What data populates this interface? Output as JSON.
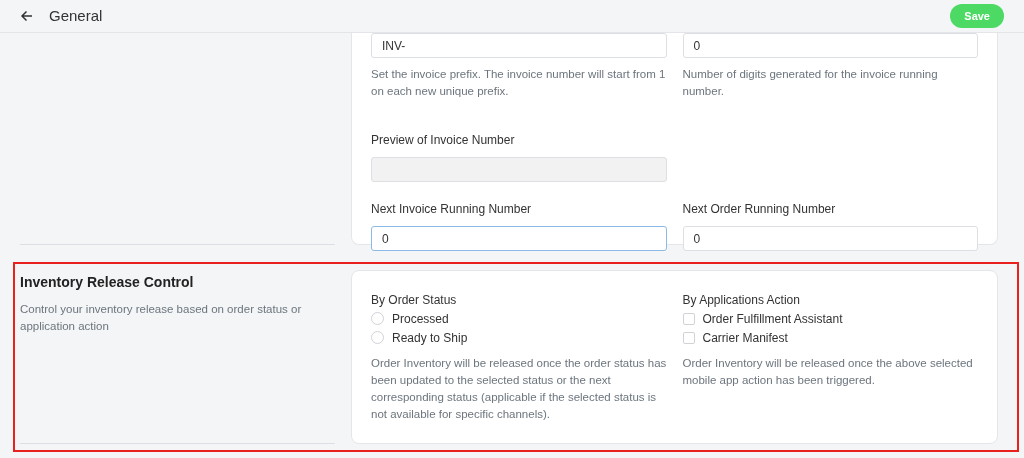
{
  "header": {
    "title": "General",
    "save_button": "Save"
  },
  "invoice_section": {
    "fields": [
      {
        "value": "INV-",
        "help": "Set the invoice prefix. The invoice number will start from 1 on each new unique prefix.",
        "focused": false,
        "disabled": false
      },
      {
        "value": "0",
        "help": "Number of digits generated for the invoice running number.",
        "focused": false,
        "disabled": false
      },
      {
        "label": "Preview of Invoice Number",
        "focused": false,
        "disabled": true
      },
      {
        "label": "Next Invoice Running Number",
        "value": "0",
        "focused": true,
        "disabled": false
      },
      {
        "label": "Next Order Running Number",
        "value": "0",
        "focused": false,
        "disabled": false
      }
    ]
  },
  "inventory_section": {
    "title": "Inventory Release Control",
    "description": "Control your inventory release based on order status or application action",
    "highlighted": true,
    "order_status": {
      "label": "By Order Status",
      "options": [
        {
          "label": "Processed",
          "selected": false
        },
        {
          "label": "Ready to Ship",
          "selected": false
        }
      ],
      "help": "Order Inventory will be released once the order status has been updated to the selected status or the next corresponding status (applicable if the selected status is not available for specific channels)."
    },
    "app_action": {
      "label": "By Applications Action",
      "options": [
        {
          "label": "Order Fulfillment Assistant",
          "checked": false
        },
        {
          "label": "Carrier Manifest",
          "checked": false
        }
      ],
      "help": "Order Inventory will be released once the above selected mobile app action has been triggered."
    }
  }
}
